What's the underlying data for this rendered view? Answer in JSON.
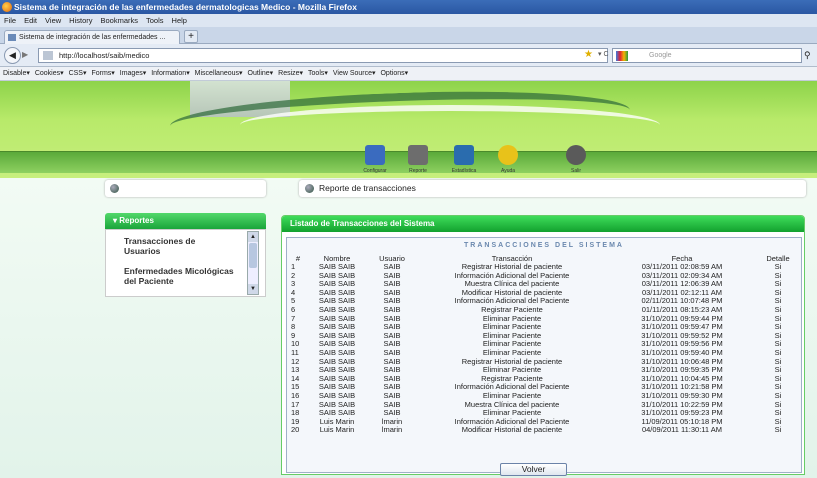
{
  "window": {
    "title": "Sistema de integración de las enfermedades dermatologicas Medico - Mozilla Firefox"
  },
  "menu": [
    "File",
    "Edit",
    "View",
    "History",
    "Bookmarks",
    "Tools",
    "Help"
  ],
  "tab": {
    "label": "Sistema de integración de las enfermedades ...",
    "new_tab": "+"
  },
  "nav": {
    "url": "http://localhost/saib/medico",
    "search_placeholder": "Google"
  },
  "devbar": [
    "Disable▾",
    "Cookies▾",
    "CSS▾",
    "Forms▾",
    "Images▾",
    "Information▾",
    "Miscellaneous▾",
    "Outline▾",
    "Resize▾",
    "Tools▾",
    "View Source▾",
    "Options▾"
  ],
  "banner_nav": [
    {
      "label": "Configurar",
      "color": "#3a6bbf"
    },
    {
      "label": "Reporte",
      "color": "#6d6d6d"
    },
    {
      "label": "Estadística",
      "color": "#2a6cae"
    },
    {
      "label": "Ayuda",
      "color": "#e8c21a"
    },
    {
      "label": "Salir",
      "color": "#5a5a5a"
    }
  ],
  "sidebar": {
    "header": "Reportes",
    "items": [
      "Transacciones de Usuarios",
      "Enfermedades Micológicas del Paciente"
    ]
  },
  "breadcrumb": "Reporte de transacciones",
  "panel": {
    "title": "Listado de Transacciones del Sistema",
    "table_title": "TRANSACCIONES DEL SISTEMA",
    "back_label": "Volver"
  },
  "table": {
    "columns": [
      "#",
      "Nombre",
      "Usuario",
      "Transacción",
      "Fecha",
      "Detalle"
    ],
    "rows": [
      [
        "1",
        "SAIB SAIB",
        "SAIB",
        "Registrar Historial de paciente",
        "03/11/2011 02:08:59 AM",
        "Si"
      ],
      [
        "2",
        "SAIB SAIB",
        "SAIB",
        "Información Adicional del Paciente",
        "03/11/2011 02:09:34 AM",
        "Si"
      ],
      [
        "3",
        "SAIB SAIB",
        "SAIB",
        "Muestra Clínica del paciente",
        "03/11/2011 12:06:39 AM",
        "Si"
      ],
      [
        "4",
        "SAIB SAIB",
        "SAIB",
        "Modificar Historial de paciente",
        "03/11/2011 02:12:11 AM",
        "Si"
      ],
      [
        "5",
        "SAIB SAIB",
        "SAIB",
        "Información Adicional del Paciente",
        "02/11/2011 10:07:48 PM",
        "Si"
      ],
      [
        "6",
        "SAIB SAIB",
        "SAIB",
        "Registrar Paciente",
        "01/11/2011 08:15:23 AM",
        "Si"
      ],
      [
        "7",
        "SAIB SAIB",
        "SAIB",
        "Eliminar Paciente",
        "31/10/2011 09:59:44 PM",
        "Si"
      ],
      [
        "8",
        "SAIB SAIB",
        "SAIB",
        "Eliminar Paciente",
        "31/10/2011 09:59:47 PM",
        "Si"
      ],
      [
        "9",
        "SAIB SAIB",
        "SAIB",
        "Eliminar Paciente",
        "31/10/2011 09:59:52 PM",
        "Si"
      ],
      [
        "10",
        "SAIB SAIB",
        "SAIB",
        "Eliminar Paciente",
        "31/10/2011 09:59:56 PM",
        "Si"
      ],
      [
        "11",
        "SAIB SAIB",
        "SAIB",
        "Eliminar Paciente",
        "31/10/2011 09:59:40 PM",
        "Si"
      ],
      [
        "12",
        "SAIB SAIB",
        "SAIB",
        "Registrar Historial de paciente",
        "31/10/2011 10:06:48 PM",
        "Si"
      ],
      [
        "13",
        "SAIB SAIB",
        "SAIB",
        "Eliminar Paciente",
        "31/10/2011 09:59:35 PM",
        "Si"
      ],
      [
        "14",
        "SAIB SAIB",
        "SAIB",
        "Registrar Paciente",
        "31/10/2011 10:04:45 PM",
        "Si"
      ],
      [
        "15",
        "SAIB SAIB",
        "SAIB",
        "Información Adicional del Paciente",
        "31/10/2011 10:21:58 PM",
        "Si"
      ],
      [
        "16",
        "SAIB SAIB",
        "SAIB",
        "Eliminar Paciente",
        "31/10/2011 09:59:30 PM",
        "Si"
      ],
      [
        "17",
        "SAIB SAIB",
        "SAIB",
        "Muestra Clínica del paciente",
        "31/10/2011 10:22:59 PM",
        "Si"
      ],
      [
        "18",
        "SAIB SAIB",
        "SAIB",
        "Eliminar Paciente",
        "31/10/2011 09:59:23 PM",
        "Si"
      ],
      [
        "19",
        "Luis Marin",
        "lmarin",
        "Información Adicional del Paciente",
        "11/09/2011 05:10:18 PM",
        "Si"
      ],
      [
        "20",
        "Luis Marin",
        "lmarin",
        "Modificar Historial de paciente",
        "04/09/2011 11:30:11 AM",
        "Si"
      ]
    ]
  }
}
